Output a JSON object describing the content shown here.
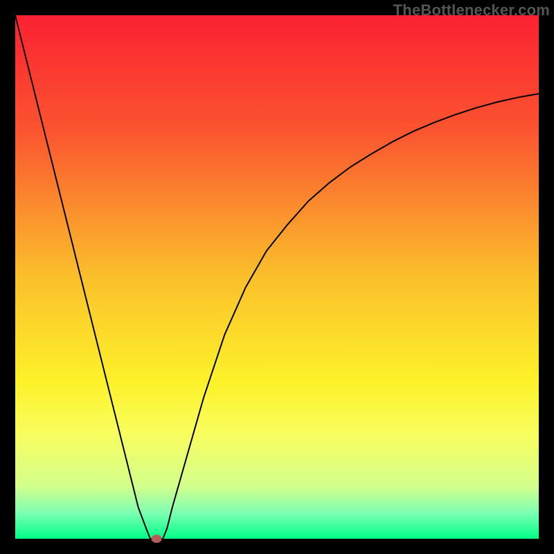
{
  "watermark": "TheBottlenecker.com",
  "colors": {
    "frame": "#000000",
    "gradient_stops": [
      {
        "pct": 0,
        "color": "#fb2131"
      },
      {
        "pct": 22,
        "color": "#fb5430"
      },
      {
        "pct": 50,
        "color": "#fbc02b"
      },
      {
        "pct": 70,
        "color": "#fdf22a"
      },
      {
        "pct": 80,
        "color": "#f8fe5f"
      },
      {
        "pct": 90,
        "color": "#d3ff8d"
      },
      {
        "pct": 95,
        "color": "#7effb2"
      },
      {
        "pct": 100,
        "color": "#00ff87"
      }
    ],
    "curve": "#000000",
    "marker_fill": "#b25c5c",
    "marker_stroke": "#8a4141"
  },
  "chart_data": {
    "type": "line",
    "title": "",
    "xlabel": "",
    "ylabel": "",
    "xlim": [
      0,
      100
    ],
    "ylim": [
      0,
      100
    ],
    "x": [
      0,
      2,
      4,
      6,
      8,
      10,
      12,
      14,
      16,
      18,
      20,
      22,
      23.5,
      25,
      26,
      27,
      28,
      29,
      30,
      32,
      34,
      36,
      38,
      40,
      44,
      48,
      52,
      56,
      60,
      64,
      68,
      72,
      76,
      80,
      84,
      88,
      92,
      96,
      100
    ],
    "values": [
      100,
      92,
      84,
      76,
      68,
      60,
      52,
      44,
      36,
      28,
      20,
      12,
      6,
      2,
      0.5,
      0,
      0.5,
      2,
      6,
      13,
      20,
      27,
      33,
      39,
      48,
      55,
      60,
      64.5,
      68,
      71,
      73.5,
      75.8,
      77.8,
      79.5,
      81,
      82.3,
      83.4,
      84.3,
      85
    ],
    "grid": false,
    "legend": false,
    "marker": {
      "x": 27,
      "y": 0
    },
    "flat_bottom_range": [
      25.8,
      28.2
    ]
  }
}
